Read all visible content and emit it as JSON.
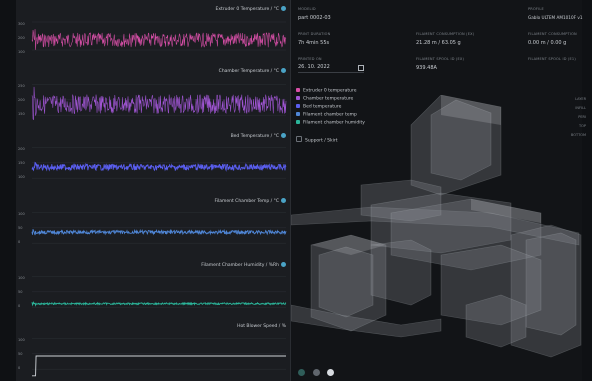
{
  "charts": [
    {
      "title": "Extruder 0 Temperature / °C",
      "yticks": [
        "300",
        "200",
        "100"
      ],
      "color": "#d84fa8",
      "base": 0.55,
      "amp": 0.18
    },
    {
      "title": "Chamber Temperature / °C",
      "yticks": [
        "250",
        "200",
        "150"
      ],
      "color": "#a256d6",
      "base": 0.55,
      "amp": 0.22
    },
    {
      "title": "Bed Temperature / °C",
      "yticks": [
        "200",
        "150",
        "100"
      ],
      "color": "#5a5ef0",
      "base": 0.55,
      "amp": 0.07
    },
    {
      "title": "Filament Chamber Temp / °C",
      "yticks": [
        "100",
        "50",
        "0"
      ],
      "color": "#4f86d6",
      "base": 0.55,
      "amp": 0.04
    },
    {
      "title": "Filament Chamber Humidity / %Rh",
      "yticks": [
        "100",
        "50",
        "0"
      ],
      "color": "#2bb59a",
      "base": 0.72,
      "amp": 0.02
    },
    {
      "title": "Hot Blower Speed / %",
      "yticks": [
        "100",
        "50",
        "0"
      ],
      "color": "#cfd3d8",
      "base": 0.5,
      "amp": 0
    }
  ],
  "details": {
    "model_label": "MODELID",
    "model_value": "part 0002-03",
    "profile_label": "PROFILE",
    "profile_value": "Gablo ULTEM AM1010F v1",
    "duration_label": "PRINT DURATION",
    "duration_value": "7h 4min 55s",
    "filcons_label": "FILAMENT CONSUMPTION (EX)",
    "filcons_value": "21.28 m / 63.05 g",
    "filcons2_label": "FILAMENT CONSUMPTION",
    "filcons2_value": "0.00 m / 0.00 g",
    "printed_label": "PRINTED ON",
    "printed_value": "26. 10. 2022",
    "spool1_label": "FILAMENT SPOOL ID (EX)",
    "spool1_value": "939.48A",
    "spool2_label": "FILAMENT SPOOL ID (E1)",
    "spool2_value": ""
  },
  "toggles": [
    {
      "label": "Extruder 0 temperature",
      "color": "#d84fa8"
    },
    {
      "label": "Chamber temperature",
      "color": "#a256d6"
    },
    {
      "label": "Bed temperature",
      "color": "#5a5ef0"
    },
    {
      "label": "Filament chamber temp",
      "color": "#4f86d6"
    },
    {
      "label": "Filament chamber humidity",
      "color": "#2bb59a"
    },
    {
      "label": "Support / Skirt",
      "color": "#3a3d42"
    }
  ],
  "side_labels": [
    "LAYER",
    "INFILL",
    "PERI",
    "TOP",
    "BOTTOM"
  ]
}
